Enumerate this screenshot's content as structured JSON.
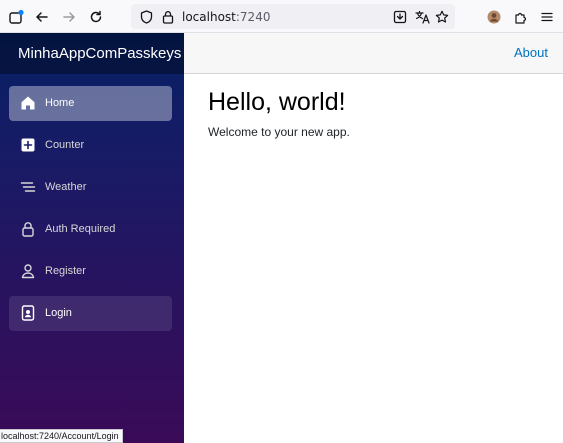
{
  "browser": {
    "url_host": "localhost",
    "url_port": ":7240",
    "buttons": {
      "tabs": "tab-overview-icon",
      "back": "back-arrow-icon",
      "forward": "forward-arrow-icon",
      "reload": "reload-icon",
      "shield": "shield-icon",
      "lock": "lock-icon",
      "save_page": "save-page-icon",
      "translate": "translate-icon",
      "bookmark": "star-icon",
      "profile": "avatar",
      "extensions": "puzzle-icon",
      "menu": "hamburger-menu-icon"
    },
    "status_url": "localhost:7240/Account/Login"
  },
  "sidebar": {
    "brand": "MinhaAppComPasskeys",
    "items": [
      {
        "label": "Home",
        "icon": "home-icon",
        "active": true
      },
      {
        "label": "Counter",
        "icon": "plus-square-icon",
        "active": false
      },
      {
        "label": "Weather",
        "icon": "list-icon",
        "active": false
      },
      {
        "label": "Auth Required",
        "icon": "lock-icon",
        "active": false
      },
      {
        "label": "Register",
        "icon": "person-icon",
        "active": false
      },
      {
        "label": "Login",
        "icon": "person-badge-icon",
        "active": false
      }
    ]
  },
  "top_row": {
    "about": "About"
  },
  "main": {
    "title": "Hello, world!",
    "text": "Welcome to your new app."
  },
  "colors": {
    "accent_link": "#0071c1",
    "sidebar_top": "#062064",
    "sidebar_bottom": "#3a0a57"
  }
}
